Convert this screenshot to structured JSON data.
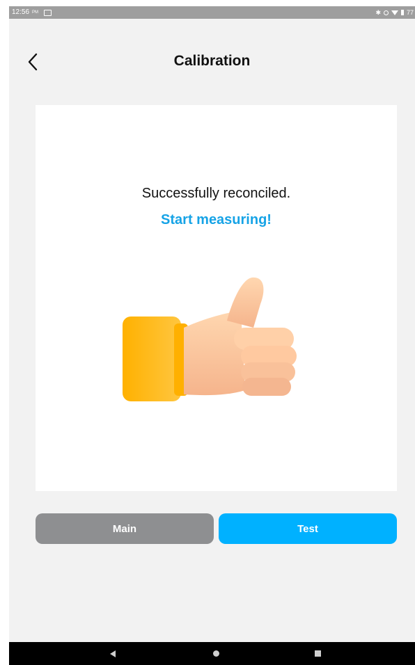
{
  "status_bar": {
    "time": "12:56",
    "ampm": "PM",
    "battery": "77"
  },
  "header": {
    "title": "Calibration"
  },
  "card": {
    "message": "Successfully reconciled.",
    "call_to_action": "Start measuring!"
  },
  "actions": {
    "main_label": "Main",
    "test_label": "Test"
  },
  "colors": {
    "accent": "#00b1ff",
    "accent_text": "#16a3e6",
    "secondary_button": "#8e8f91",
    "background": "#f2f2f2"
  },
  "icons": {
    "back": "chevron-left-icon",
    "illustration": "thumbs-up-icon"
  }
}
